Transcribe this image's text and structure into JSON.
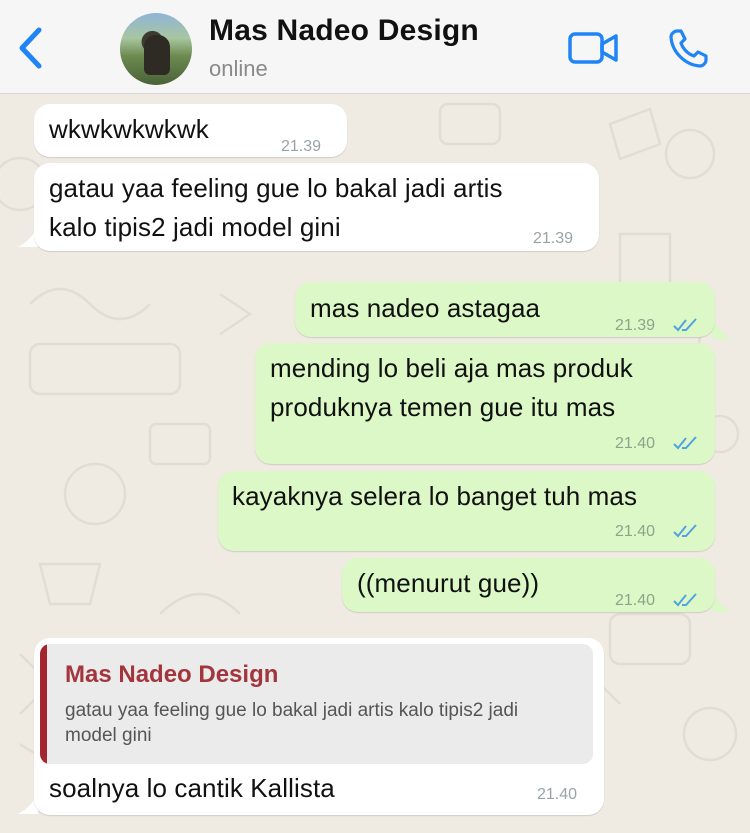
{
  "header": {
    "contact_name": "Mas Nadeo Design",
    "status": "online",
    "icons": [
      "back-chevron-icon",
      "video-call-icon",
      "phone-call-icon"
    ],
    "accent_color": "#1f84f5"
  },
  "messages": [
    {
      "direction": "incoming",
      "text": "wkwkwkwkwk",
      "time": "21.39"
    },
    {
      "direction": "incoming",
      "lines": [
        "gatau yaa feeling gue lo bakal jadi artis",
        "kalo tipis2 jadi model gini"
      ],
      "time": "21.39"
    },
    {
      "direction": "outgoing",
      "text": "mas nadeo astagaa",
      "time": "21.39",
      "read": true
    },
    {
      "direction": "outgoing",
      "lines": [
        "mending lo beli aja mas produk",
        "produknya temen gue itu mas"
      ],
      "time": "21.40",
      "read": true
    },
    {
      "direction": "outgoing",
      "text": "kayaknya selera lo banget tuh mas",
      "time": "21.40",
      "read": true
    },
    {
      "direction": "outgoing",
      "text": "((menurut gue))",
      "time": "21.40",
      "read": true
    },
    {
      "direction": "incoming",
      "reply_to": {
        "author": "Mas Nadeo Design",
        "text": "gatau yaa feeling gue lo bakal jadi artis kalo tipis2 jadi model gini"
      },
      "text": "soalnya lo cantik Kallista",
      "time": "21.40"
    }
  ],
  "colors": {
    "incoming_bubble": "#ffffff",
    "outgoing_bubble": "#dcf8c6",
    "read_ticks": "#4fa3e0",
    "quote_accent": "#a3262e",
    "chat_background": "#efeae2"
  }
}
